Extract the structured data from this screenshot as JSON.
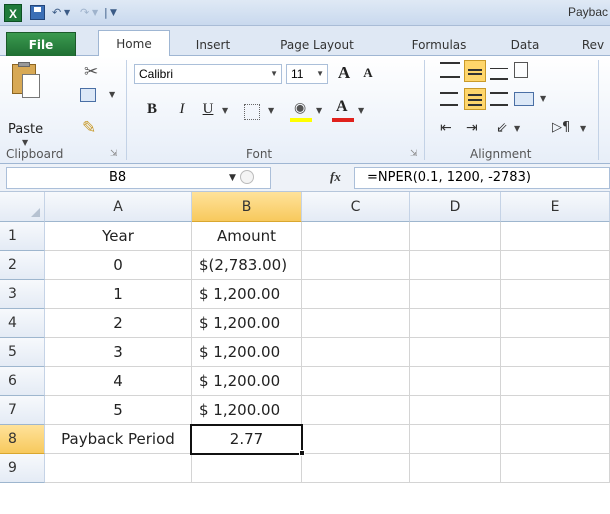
{
  "title_bar": {
    "title": "Paybac",
    "excel_icon_letter": "X"
  },
  "tabs": [
    {
      "label": "File"
    },
    {
      "label": "Home"
    },
    {
      "label": "Insert"
    },
    {
      "label": "Page Layout"
    },
    {
      "label": "Formulas"
    },
    {
      "label": "Data"
    },
    {
      "label": "Rev"
    }
  ],
  "ribbon": {
    "clipboard": {
      "paste_label": "Paste",
      "group_label": "Clipboard"
    },
    "font": {
      "family": "Calibri",
      "size": "11",
      "bold": "B",
      "italic": "I",
      "underline": "U",
      "grow": "A",
      "shrink": "A",
      "color_letter": "A",
      "group_label": "Font"
    },
    "alignment": {
      "group_label": "Alignment"
    }
  },
  "formula_bar": {
    "name_box": "B8",
    "fx": "fx",
    "formula": "=NPER(0.1, 1200, -2783)"
  },
  "grid": {
    "columns": [
      "A",
      "B",
      "C",
      "D",
      "E"
    ],
    "selected_column": "B",
    "selected_row": "8",
    "rows": [
      {
        "num": "1",
        "a": "Year",
        "b": "Amount"
      },
      {
        "num": "2",
        "a": "0",
        "b": "$(2,783.00)"
      },
      {
        "num": "3",
        "a": "1",
        "b": "$ 1,200.00"
      },
      {
        "num": "4",
        "a": "2",
        "b": "$ 1,200.00"
      },
      {
        "num": "5",
        "a": "3",
        "b": "$ 1,200.00"
      },
      {
        "num": "6",
        "a": "4",
        "b": "$ 1,200.00"
      },
      {
        "num": "7",
        "a": "5",
        "b": "$ 1,200.00"
      },
      {
        "num": "8",
        "a": "Payback Period",
        "b": "2.77"
      },
      {
        "num": "9",
        "a": "",
        "b": ""
      }
    ]
  },
  "colors": {
    "file_tab": "#2a8a3f",
    "selected_header": "#f7c95d",
    "alignment_active": "#ffd66b"
  }
}
